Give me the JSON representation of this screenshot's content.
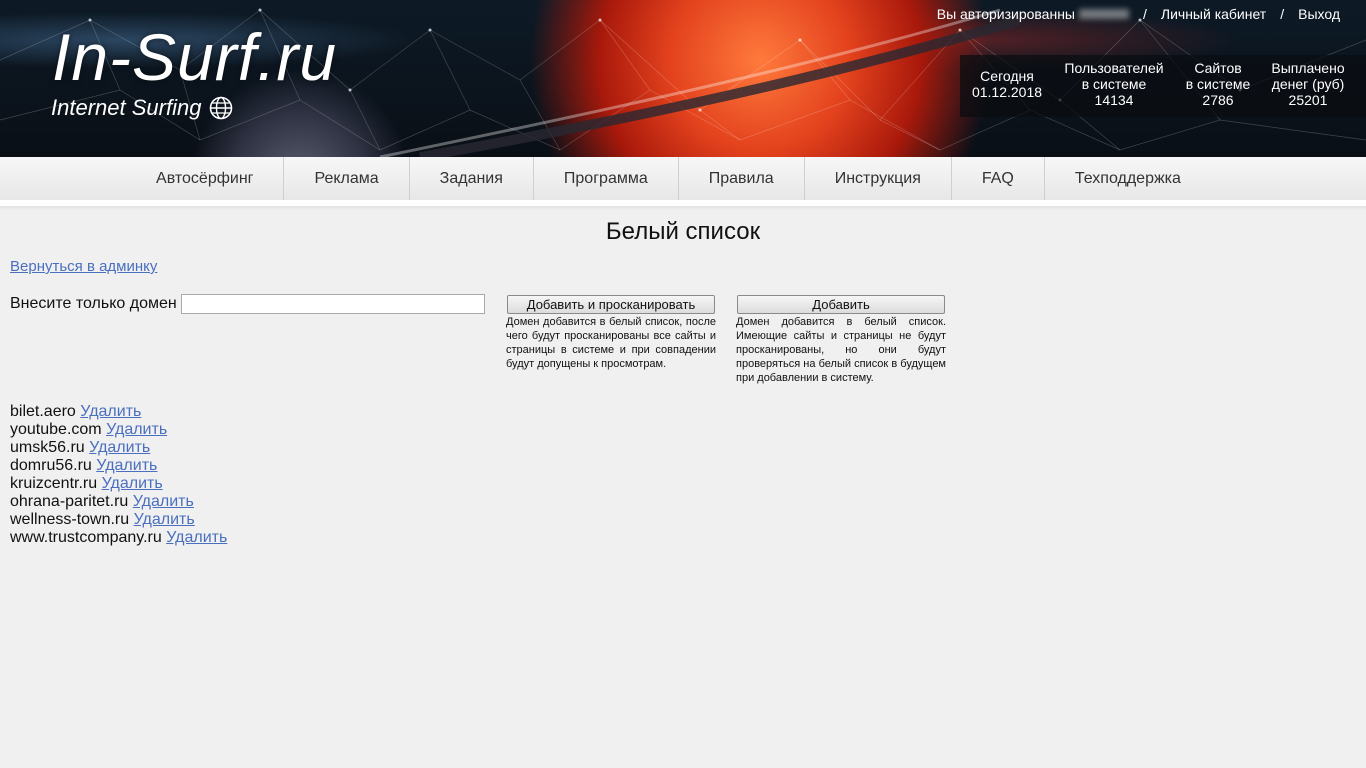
{
  "header": {
    "logo_main": "In-Surf.ru",
    "logo_sub": "Internet Surfing",
    "auth_text": "Вы авторизированны",
    "cabinet_link": "Личный кабинет",
    "logout_link": "Выход",
    "separator": "/",
    "stats": [
      {
        "label1": "Сегодня",
        "label2": "",
        "value": "01.12.2018"
      },
      {
        "label1": "Пользователей",
        "label2": "в системе",
        "value": "14134"
      },
      {
        "label1": "Сайтов",
        "label2": "в системе",
        "value": "2786"
      },
      {
        "label1": "Выплачено",
        "label2": "денег (руб)",
        "value": "25201"
      }
    ]
  },
  "nav": {
    "items": [
      "Автосёрфинг",
      "Реклама",
      "Задания",
      "Программа",
      "Правила",
      "Инструкция",
      "FAQ",
      "Техподдержка"
    ]
  },
  "main": {
    "title": "Белый список",
    "back_link": "Вернуться в админку",
    "domain_label": "Внесите только домен",
    "domain_value": "",
    "button_scan": "Добавить и просканировать",
    "button_add": "Добавить",
    "hint_scan": "Домен добавится в белый список, после чего будут просканированы все сайты и страницы в системе и при совпадении будут допущены к просмотрам.",
    "hint_add": "Домен добавится в белый список. Имеющие сайты и страницы не будут просканированы, но они будут проверяться на белый список в будущем при добавлении в систему.",
    "delete_label": "Удалить",
    "domains": [
      "bilet.aero",
      "youtube.com",
      "umsk56.ru",
      "domru56.ru",
      "kruizcentr.ru",
      "ohrana-paritet.ru",
      "wellness-town.ru",
      "www.trustcompany.ru"
    ]
  },
  "colors": {
    "link": "#4a6fbf",
    "background": "#f0f0f0"
  }
}
